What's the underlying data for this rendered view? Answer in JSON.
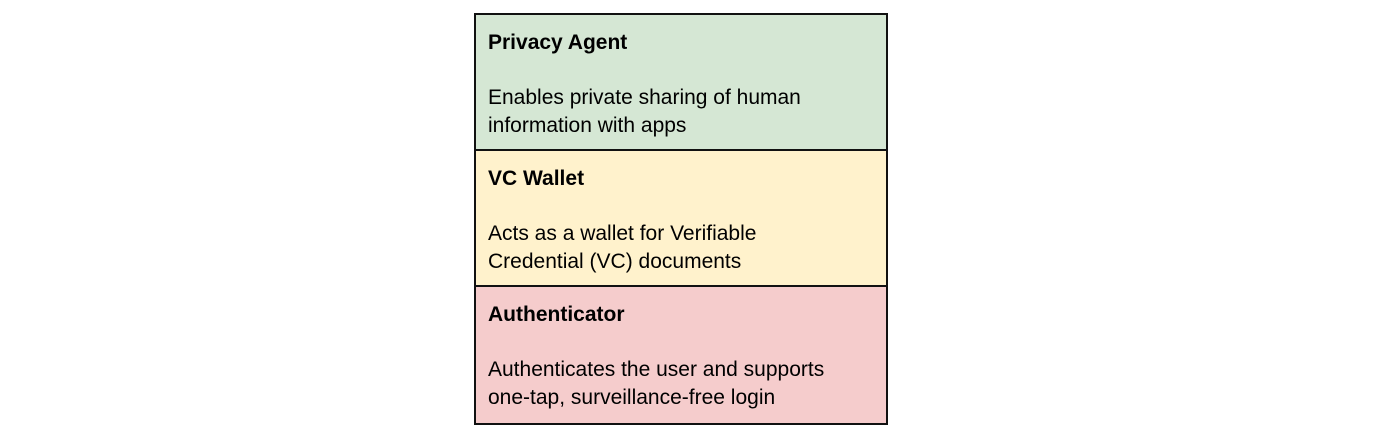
{
  "layers": [
    {
      "title": "Privacy Agent",
      "description_line1": "Enables private sharing of human",
      "description_line2": "information with apps",
      "color": "#d5e7d4"
    },
    {
      "title": "VC Wallet",
      "description_line1": "Acts as a wallet for Verifiable",
      "description_line2": "Credential (VC) documents",
      "color": "#fff2cc"
    },
    {
      "title": "Authenticator",
      "description_line1": "Authenticates the user and supports",
      "description_line2": "one-tap, surveillance-free login",
      "color": "#f5cccc"
    }
  ]
}
